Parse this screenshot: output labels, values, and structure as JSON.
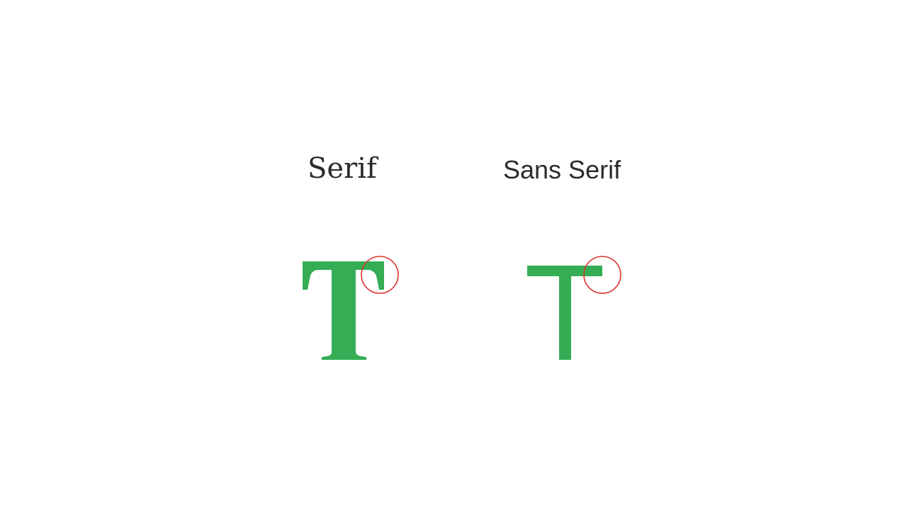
{
  "slide": {
    "serif_label": "Serif",
    "sans_serif_label": "Sans Serif"
  },
  "colors": {
    "background": "#ffffff",
    "glyph_fill": "#34ad55",
    "highlight_circle": "#d9342b",
    "label_text": "#2b2b2b"
  }
}
